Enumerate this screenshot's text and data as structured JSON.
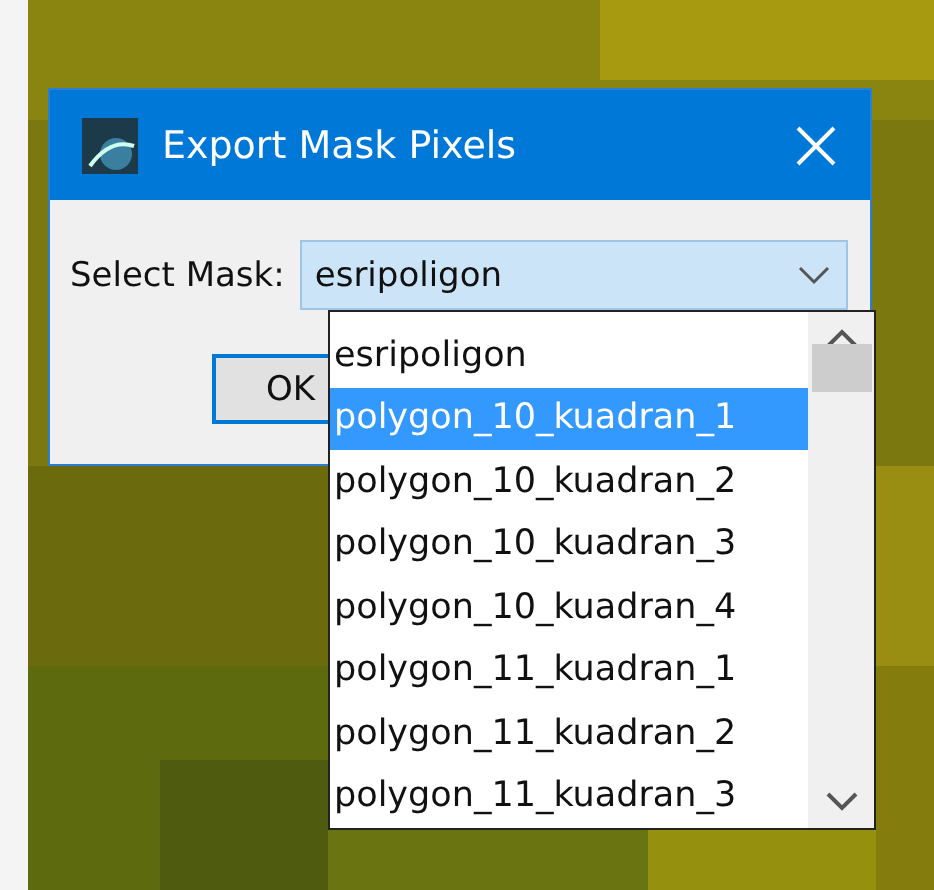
{
  "dialog": {
    "title": "Export Mask Pixels",
    "label": "Select Mask:",
    "combo_value": "esripoligon",
    "ok_button": "OK"
  },
  "dropdown": {
    "items": [
      {
        "label": "esripoligon",
        "selected": false
      },
      {
        "label": "polygon_10_kuadran_1",
        "selected": true
      },
      {
        "label": "polygon_10_kuadran_2",
        "selected": false
      },
      {
        "label": "polygon_10_kuadran_3",
        "selected": false
      },
      {
        "label": "polygon_10_kuadran_4",
        "selected": false
      },
      {
        "label": "polygon_11_kuadran_1",
        "selected": false
      },
      {
        "label": "polygon_11_kuadran_2",
        "selected": false
      },
      {
        "label": "polygon_11_kuadran_3",
        "selected": false
      }
    ]
  }
}
